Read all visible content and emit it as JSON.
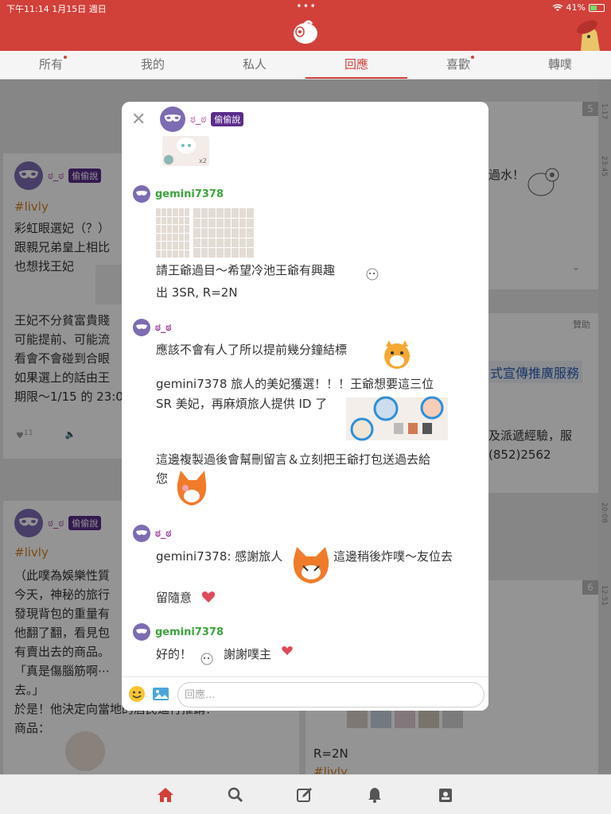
{
  "status": {
    "time": "下午11:14 1月15日 週日",
    "battery": "41%"
  },
  "tabs": [
    {
      "label": "所有",
      "dot": true
    },
    {
      "label": "我的",
      "dot": false
    },
    {
      "label": "私人",
      "dot": false
    },
    {
      "label": "回應",
      "dot": false
    },
    {
      "label": "喜歡",
      "dot": true
    },
    {
      "label": "轉噗",
      "dot": false
    }
  ],
  "active_tab": "回應",
  "feed": {
    "post1": {
      "user": "ಠ_ಠ",
      "badge": "偷偷說",
      "hashtag": "#livly",
      "lines": [
        "彩虹眼選妃（？）",
        "跟親兄弟皇上相比",
        "也想找王妃",
        "",
        "",
        "王妃不分貧富貴賤",
        "可能提前、可能流",
        "看會不會碰到合眼",
        "如果選上的話由王",
        "期限～1/15 的 23:0"
      ],
      "likes": "11"
    },
    "post2": {
      "user": "ಠ_ಠ",
      "badge": "偷偷說",
      "hashtag": "#livly",
      "lines": [
        "（此噗為娛樂性質",
        "今天，神秘的旅行",
        "發現背包的重量有",
        "他翻了翻，看見包",
        "有賣出去的商品。",
        "「真是傷腦筋啊⋯",
        "去。」",
        "於是！他決定向當地的居民進行推銷！",
        "商品："
      ]
    },
    "right_col": {
      "count1": "5",
      "snippet1": "過水！",
      "sponsor": "贊助",
      "ad_title": "式宣傳推廣服務",
      "ad_line1": "及派遞經驗，服",
      "ad_line2": "(852)2562",
      "count2": "6",
      "rline": "R=2N",
      "rhash": "#livly"
    },
    "timeline": [
      "1:17",
      "23:45",
      "20:08",
      "12:51"
    ]
  },
  "modal": {
    "user": "ಠ_ಠ",
    "badge": "偷偷說",
    "top_thumb_label": "x2",
    "replies": [
      {
        "user": "gemini7378",
        "line1": "請王爺過目～希望冷池王爺有興趣",
        "line2": "出 3SR, R=2N"
      },
      {
        "user": "ಠ_ಠ",
        "line1": "應該不會有人了所以提前幾分鐘結標",
        "line2": "gemini7378 旅人的美妃獲選！！！王爺想要這三位",
        "line3": "SR 美妃，再麻煩旅人提供 ID 了",
        "line4": "這邊複製過後會幫刪留言＆立刻把王爺打包送過去給",
        "line5": "您"
      },
      {
        "user": "ಠ_ಠ",
        "line1a": "gemini7378: 感謝旅人",
        "line1b": "這邊稍後炸噗～友位去",
        "line2": "留隨意"
      },
      {
        "user": "gemini7378",
        "line1a": "好的！",
        "line1b": "謝謝噗主"
      }
    ],
    "composer": {
      "placeholder": "回應..."
    }
  },
  "colors": {
    "brand": "#d2403a",
    "green_name": "#3aa53a",
    "purple_name": "#9c3fa0"
  }
}
